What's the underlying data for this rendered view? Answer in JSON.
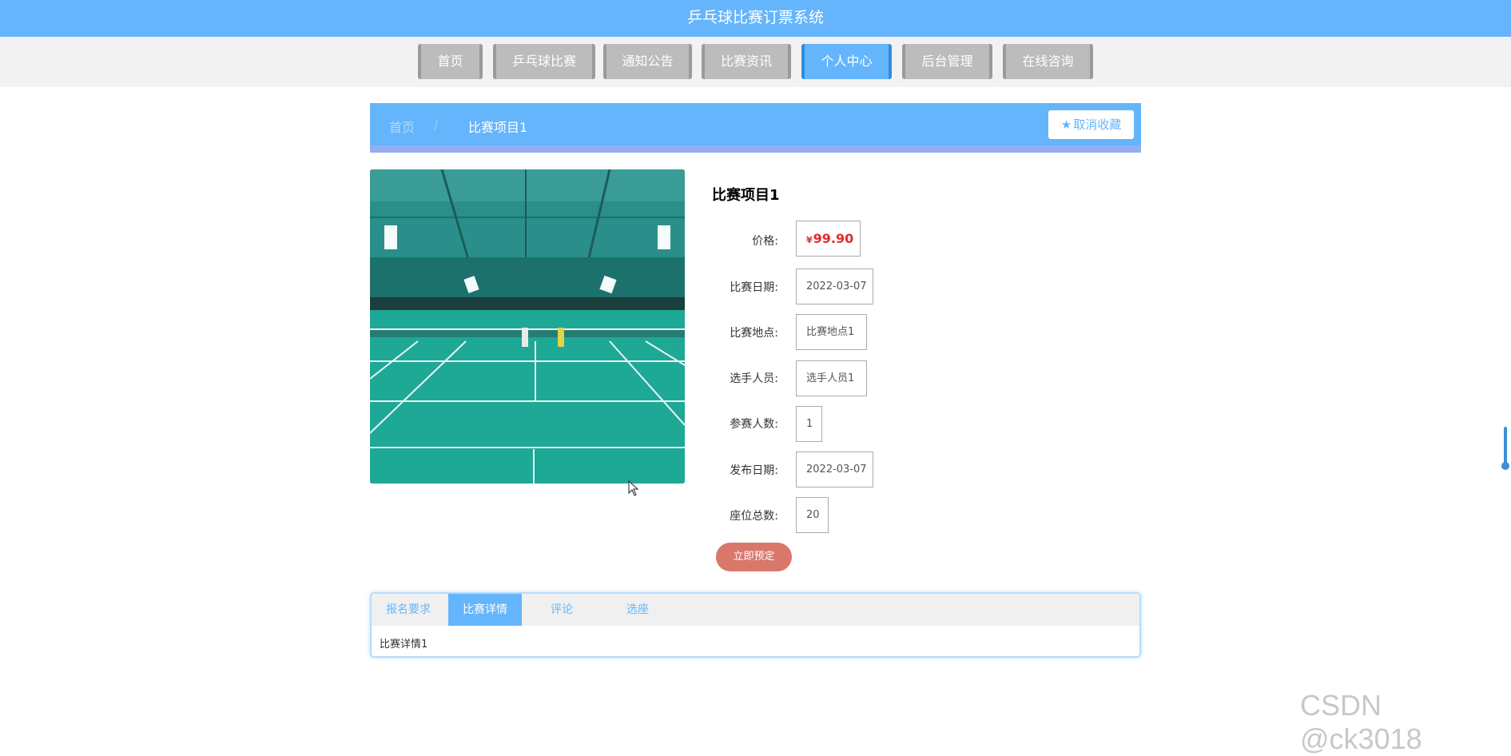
{
  "header": {
    "title": "乒乓球比赛订票系统"
  },
  "nav": {
    "items": [
      {
        "label": "首页"
      },
      {
        "label": "乒乓球比赛"
      },
      {
        "label": "通知公告"
      },
      {
        "label": "比赛资讯"
      },
      {
        "label": "个人中心",
        "active": true
      },
      {
        "label": "后台管理"
      },
      {
        "label": "在线咨询"
      }
    ]
  },
  "breadcrumb": {
    "home": "首页",
    "separator": "/",
    "current": "比赛项目1",
    "favorite_label": "取消收藏"
  },
  "product": {
    "title": "比赛项目1",
    "price_currency": "¥",
    "price_value": "99.90",
    "fields": [
      {
        "label": "价格:"
      },
      {
        "label": "比赛日期:",
        "value": "2022-03-07"
      },
      {
        "label": "比赛地点:",
        "value": "比赛地点1"
      },
      {
        "label": "选手人员:",
        "value": "选手人员1"
      },
      {
        "label": "参赛人数:",
        "value": "1"
      },
      {
        "label": "发布日期:",
        "value": "2022-03-07"
      },
      {
        "label": "座位总数:",
        "value": "20"
      }
    ],
    "book_label": "立即预定"
  },
  "tabs": {
    "items": [
      {
        "label": "报名要求"
      },
      {
        "label": "比赛详情",
        "active": true
      },
      {
        "label": "评论"
      },
      {
        "label": "选座"
      }
    ],
    "content": "比赛详情1"
  },
  "watermark": "CSDN @ck3018",
  "colors": {
    "primary": "#64b5fb",
    "price": "#e02d2d",
    "book": "#d9776b",
    "nav_inactive": "#bcbcbc"
  },
  "icons": {
    "favorite": "star-icon",
    "cursor": "mouse-pointer-icon"
  }
}
